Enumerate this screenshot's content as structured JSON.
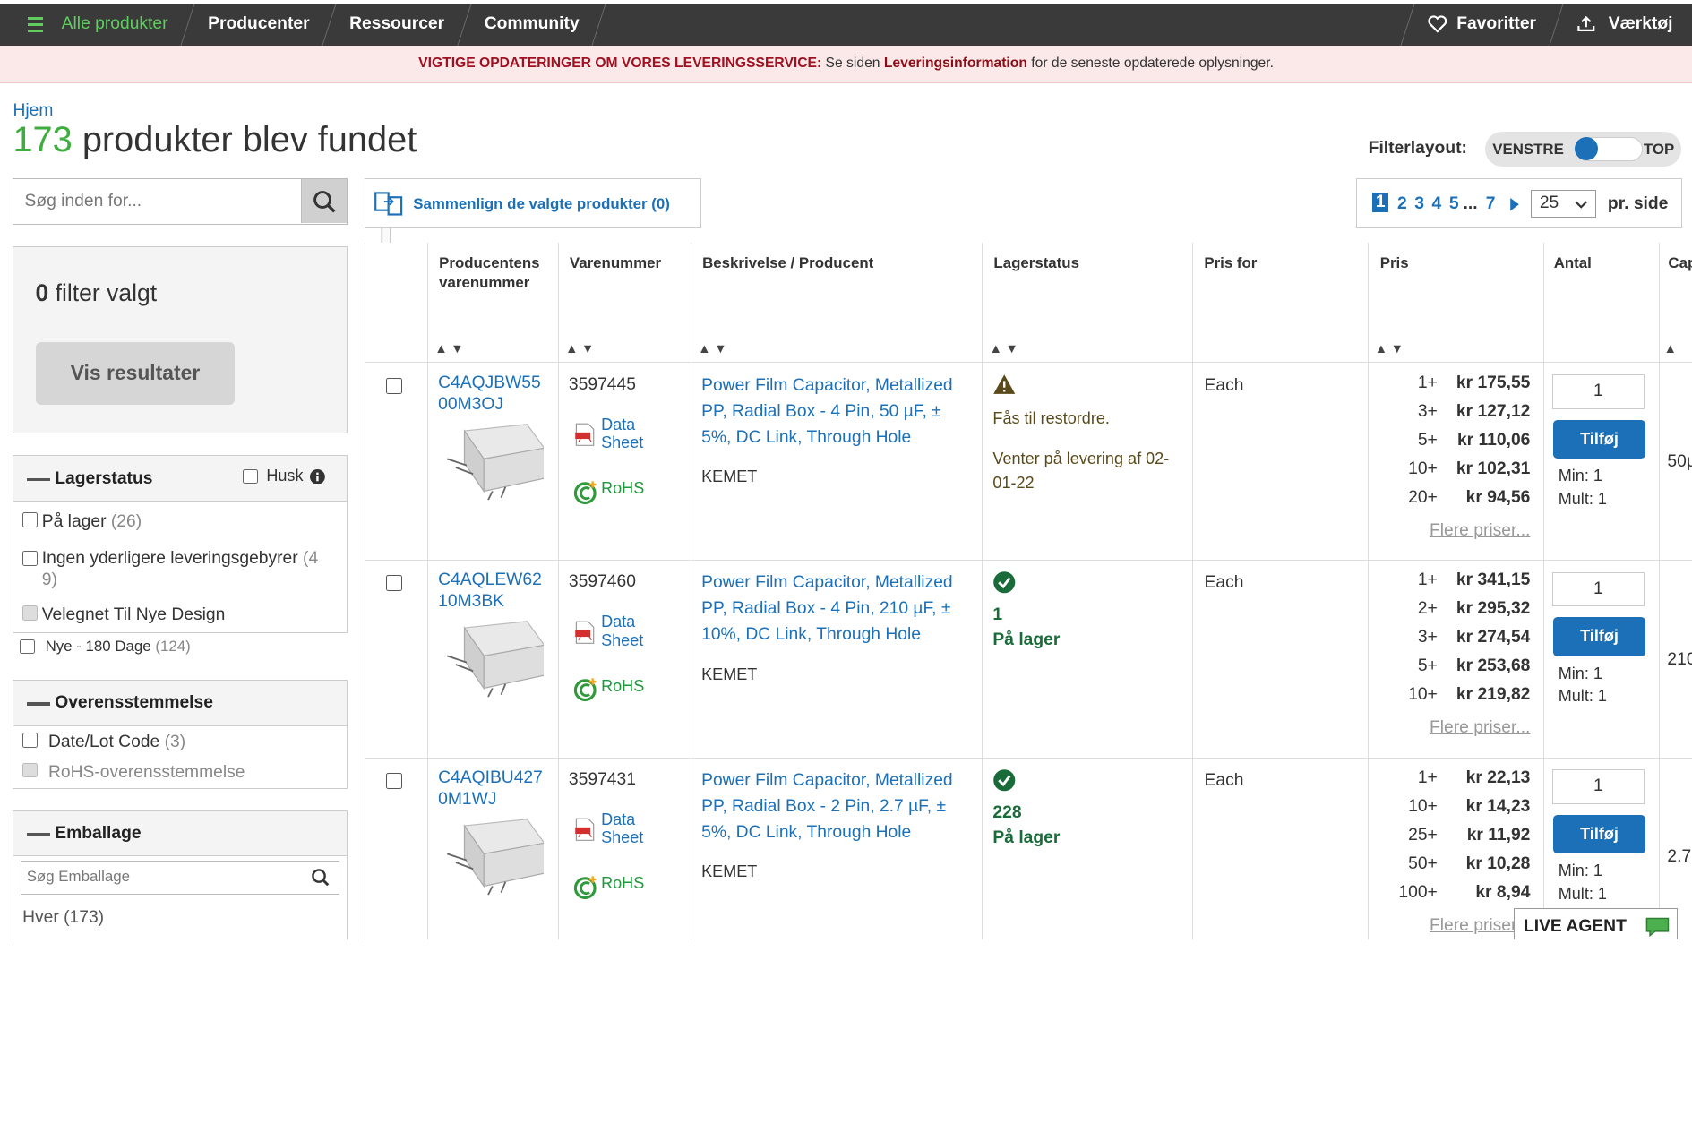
{
  "nav": {
    "items": [
      "Alle produkter",
      "Producenter",
      "Ressourcer",
      "Community"
    ],
    "favorites": "Favoritter",
    "tools": "Værktøj"
  },
  "alert": {
    "bold": "VIGTIGE OPDATERINGER OM VORES LEVERINGSSERVICE:",
    "text1": " Se siden ",
    "link": "Leveringsinformation",
    "text2": " for de seneste opdaterede oplysninger."
  },
  "breadcrumb": "Hjem",
  "result": {
    "count": "173",
    "text": " produkter blev fundet"
  },
  "filter_layout": {
    "label": "Filterlayout:",
    "left": "VENSTRE",
    "top": "TOP"
  },
  "search": {
    "placeholder": "Søg inden for..."
  },
  "filters_selected": {
    "count": "0",
    "label": " filter valgt",
    "button": "Vis resultater"
  },
  "stock_section": {
    "title": "Lagerstatus",
    "remember": "Husk",
    "options": [
      {
        "label": "På lager",
        "count": "(26)"
      },
      {
        "label": "Ingen yderligere leveringsgebyrer",
        "count": "(4",
        "count2": "9)"
      },
      {
        "label": "Velegnet Til Nye Design"
      },
      {
        "label": "Nye - 180 Dage",
        "count": "(124)"
      }
    ]
  },
  "compliance_section": {
    "title": "Overensstemmelse",
    "options": [
      {
        "label": "Date/Lot Code",
        "count": "(3)"
      },
      {
        "label": "RoHS-overensstemmelse"
      }
    ]
  },
  "packaging_section": {
    "title": "Emballage",
    "search_placeholder": "Søg Emballage",
    "options": [
      {
        "label": "Hver",
        "count": "(173)"
      }
    ]
  },
  "compare": {
    "label": "Sammenlign de valgte produkter (0)"
  },
  "pagination": {
    "pages": [
      "1",
      "2",
      "3",
      "4",
      "5"
    ],
    "ellipsis": "...",
    "last": "7",
    "per_page": "25",
    "per_label": "pr. side"
  },
  "table": {
    "headers": {
      "mpn": [
        "Producentens",
        "varenummer"
      ],
      "order": "Varenummer",
      "desc": "Beskrivelse / Producent",
      "stock": "Lagerstatus",
      "price_for": "Pris for",
      "price": "Pris",
      "qty": "Antal",
      "cap": "Cap"
    },
    "rows": [
      {
        "mpn": [
          "C4AQJBW55",
          "00M3OJ"
        ],
        "order": "3597445",
        "datasheet": [
          "Data",
          "Sheet"
        ],
        "rohs": "RoHS",
        "desc": [
          "Power Film Capacitor, Metallized",
          "PP, Radial Box - 4 Pin, 50 µF, ±",
          "5%, DC Link, Through Hole"
        ],
        "mfr": "KEMET",
        "stock_line1": "Fås til restordre.",
        "stock_line2": [
          "Venter på levering af 02-",
          "01-22"
        ],
        "price_for": "Each",
        "prices": [
          [
            "1+",
            "kr 175,55"
          ],
          [
            "3+",
            "kr 127,12"
          ],
          [
            "5+",
            "kr 110,06"
          ],
          [
            "10+",
            "kr 102,31"
          ],
          [
            "20+",
            "kr 94,56"
          ]
        ],
        "more": "Flere priser...",
        "qty": "1",
        "add": "Tilføj",
        "min": "Min: 1",
        "mult": "Mult: 1",
        "cap": "50µ"
      },
      {
        "mpn": [
          "C4AQLEW62",
          "10M3BK"
        ],
        "order": "3597460",
        "datasheet": [
          "Data",
          "Sheet"
        ],
        "rohs": "RoHS",
        "desc": [
          "Power Film Capacitor, Metallized",
          "PP, Radial Box - 4 Pin, 210 µF, ±",
          "10%, DC Link, Through Hole"
        ],
        "mfr": "KEMET",
        "stock_qty": "1",
        "stock_label": "På lager",
        "price_for": "Each",
        "prices": [
          [
            "1+",
            "kr 341,15"
          ],
          [
            "2+",
            "kr 295,32"
          ],
          [
            "3+",
            "kr 274,54"
          ],
          [
            "5+",
            "kr 253,68"
          ],
          [
            "10+",
            "kr 219,82"
          ]
        ],
        "more": "Flere priser...",
        "qty": "1",
        "add": "Tilføj",
        "min": "Min: 1",
        "mult": "Mult: 1",
        "cap": "210"
      },
      {
        "mpn": [
          "C4AQIBU427",
          "0M1WJ"
        ],
        "order": "3597431",
        "datasheet": [
          "Data",
          "Sheet"
        ],
        "rohs": "RoHS",
        "desc": [
          "Power Film Capacitor, Metallized",
          "PP, Radial Box - 2 Pin, 2.7 µF, ±",
          "5%, DC Link, Through Hole"
        ],
        "mfr": "KEMET",
        "stock_qty": "228",
        "stock_label": "På lager",
        "price_for": "Each",
        "prices": [
          [
            "1+",
            "kr 22,13"
          ],
          [
            "10+",
            "kr 14,23"
          ],
          [
            "25+",
            "kr 11,92"
          ],
          [
            "50+",
            "kr 10,28"
          ],
          [
            "100+",
            "kr 8,94"
          ]
        ],
        "more": "Flere priser...",
        "qty": "1",
        "add": "Tilføj",
        "min": "Min: 1",
        "mult": "Mult: 1",
        "cap": "2.7"
      }
    ]
  },
  "live_agent": "LIVE AGENT",
  "colors": {
    "accent": "#1c70b8",
    "green": "#3cae3c",
    "alert_bg": "#fbe9e9",
    "nav_bg": "#3a3a3a"
  }
}
